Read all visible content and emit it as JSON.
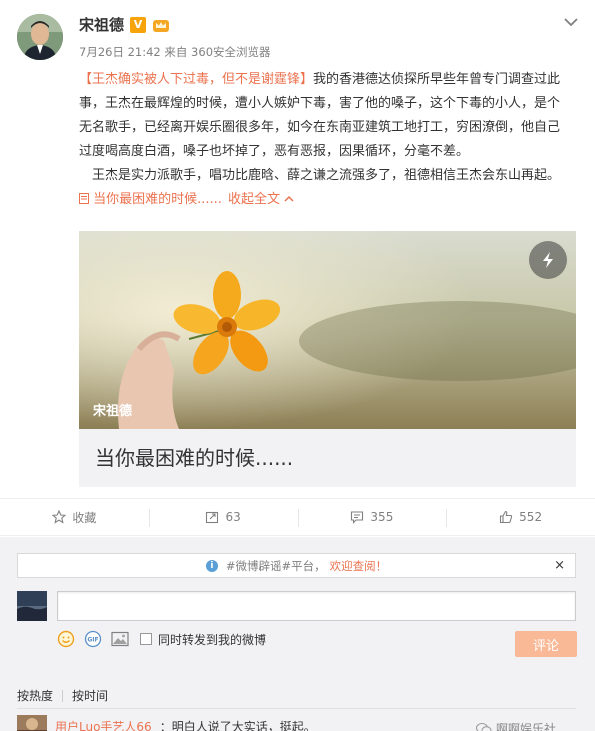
{
  "post": {
    "author": "宋祖德",
    "verified_badge": "V",
    "date": "7月26日 21:42",
    "source": "来自 360安全浏览器",
    "paragraph1_highlight": "【王杰确实被人下过毒，但不是谢霆锋】",
    "paragraph1_text": "我的香港德达侦探所早些年曾专门调查过此事，王杰在最辉煌的时候，遭小人嫉妒下毒，害了他的嗓子，这个下毒的小人，是个无名歌手，已经离开娱乐圈很多年，如今在东南亚建筑工地打工，穷困潦倒，他自己过度喝高度白酒，嗓子也坏掉了，恶有恶报，因果循环，分毫不差。",
    "paragraph2_text": "王杰是实力派歌手，唱功比鹿晗、薛之谦之流强多了，祖德相信王杰会东山再起。",
    "inline_link": "当你最困难的时候......",
    "collapse_label": "收起全文",
    "collapse_icon": "chevron-up-icon"
  },
  "card": {
    "watermark": "宋祖德",
    "title": "当你最困难的时候......",
    "play_icon": "lightning-icon"
  },
  "actions": {
    "favorite": "收藏",
    "repost": "63",
    "comment": "355",
    "like": "552"
  },
  "comment_box": {
    "notice_hash": "#微博辟谣#平台，",
    "notice_warn": "欢迎查阅！",
    "notice_close": "×",
    "forward_label": "同时转发到我的微博",
    "submit_label": "评论"
  },
  "sort": {
    "by_hot": "按热度",
    "by_time": "按时间"
  },
  "comments": [
    {
      "user": "用户Luo手艺人66",
      "text": "：明白人说了大实话，挺起。"
    }
  ],
  "watermark_partial": "啊啊娱乐社",
  "colors": {
    "accent": "#eb7350",
    "verified": "#f7a30b",
    "submit_disabled": "#fab996",
    "background_gray": "#f2f2f5"
  }
}
